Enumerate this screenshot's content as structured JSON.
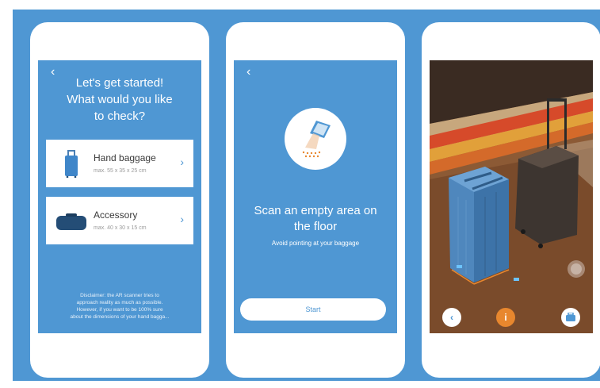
{
  "screens": {
    "start": {
      "back_icon": "‹",
      "title_line1": "Let's get started!",
      "title_line2": "What would you like",
      "title_line3": "to check?",
      "cards": [
        {
          "name": "Hand baggage",
          "size": "max. 55 x 35 x 25 cm",
          "icon": "suitcase-icon"
        },
        {
          "name": "Accessory",
          "size": "max. 40 x 30 x 15 cm",
          "icon": "bag-icon"
        }
      ],
      "chevron": "›",
      "disclaimer_line1": "Disclaimer: the AR scanner tries to",
      "disclaimer_line2": "approach reality as much as possible.",
      "disclaimer_line3": "However, if you want to be 100% sure",
      "disclaimer_line4": "about the dimensions of your hand bagga..."
    },
    "scan": {
      "back_icon": "‹",
      "title_line1": "Scan an empty area on",
      "title_line2": "the floor",
      "subtitle": "Avoid pointing at your baggage",
      "start_label": "Start"
    },
    "ar": {
      "back_icon": "‹",
      "info_icon": "i"
    }
  },
  "colors": {
    "brand_blue": "#4f97d3",
    "accent_orange": "#e8872e",
    "white": "#ffffff"
  }
}
